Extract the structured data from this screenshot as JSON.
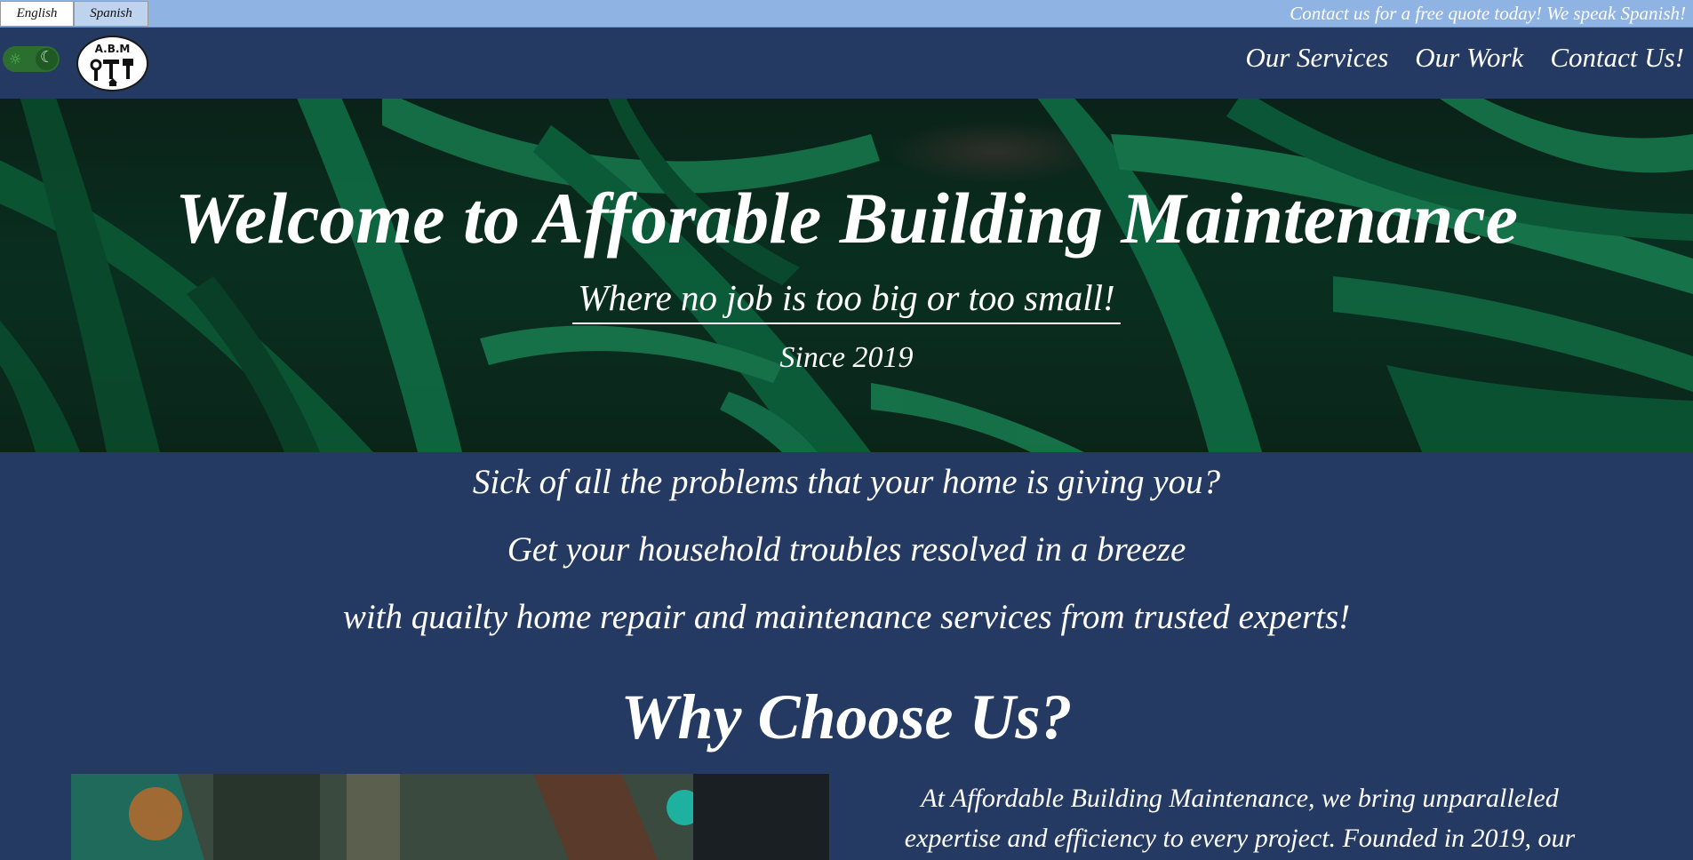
{
  "language_bar": {
    "english_label": "English",
    "spanish_label": "Spanish",
    "announcement": "Contact us for a free quote today! We speak Spanish!"
  },
  "header": {
    "logo_text": "A.B.M",
    "nav": [
      {
        "label": "Our Services"
      },
      {
        "label": "Our Work"
      },
      {
        "label": "Contact Us!"
      }
    ]
  },
  "hero": {
    "title": "Welcome to Afforable Building Maintenance",
    "subtitle": "Where no job is too big or too small!",
    "since": "Since 2019"
  },
  "intro": {
    "lines": [
      "Sick of all the problems that your home is giving you?",
      "Get your household troubles resolved in a breeze",
      "with quailty home repair and maintenance services from trusted experts!"
    ]
  },
  "why": {
    "title": "Why Choose Us?",
    "text": "At Affordable Building Maintenance, we bring unparalleled expertise and efficiency to every project. Founded in 2019, our"
  },
  "icons": {
    "theme_toggle_light": "sun-icon",
    "theme_toggle_dark": "moon-icon"
  },
  "colors": {
    "page_background": "#243a63",
    "language_bar": "#8fb4e3",
    "toggle": "#2b6e30",
    "text": "#ffffff"
  }
}
